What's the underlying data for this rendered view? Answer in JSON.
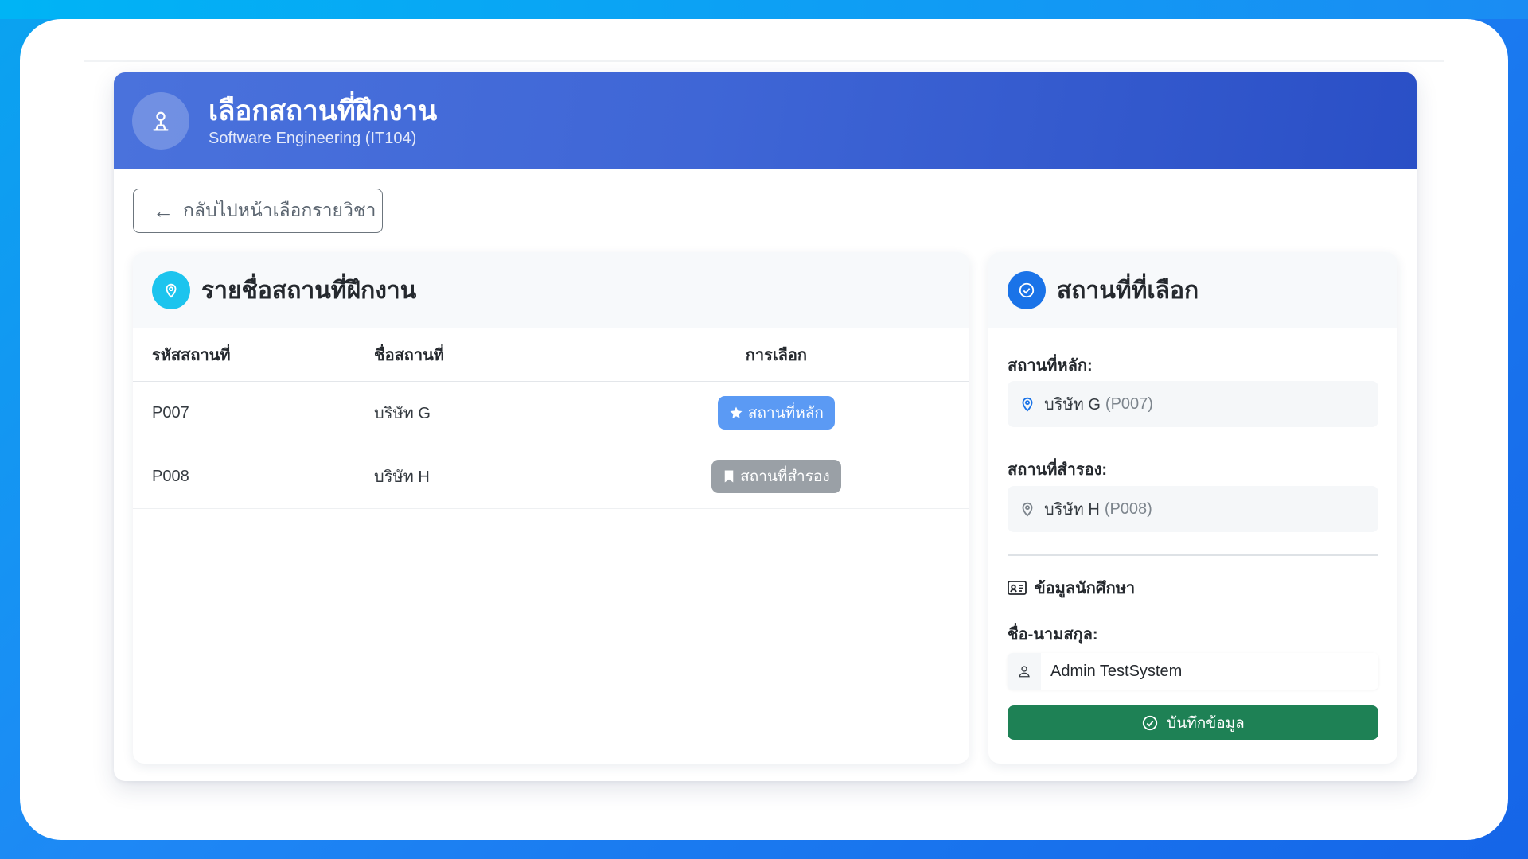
{
  "header": {
    "title": "เลือกสถานที่ฝึกงาน",
    "subtitle": "Software Engineering (IT104)",
    "icon": "user-location-icon"
  },
  "back_button": {
    "label": "กลับไปหน้าเลือกรายวิชา",
    "icon": "arrow-left-icon"
  },
  "places_panel": {
    "title": "รายชื่อสถานที่ฝึกงาน",
    "icon": "map-pin-icon",
    "columns": [
      "รหัสสถานที่",
      "ชื่อสถานที่",
      "การเลือก"
    ],
    "rows": [
      {
        "code": "P007",
        "name": "บริษัท G",
        "choice": "สถานที่หลัก",
        "choice_icon": "star-icon"
      },
      {
        "code": "P008",
        "name": "บริษัท H",
        "choice": "สถานที่สำรอง",
        "choice_icon": "bookmark-icon"
      }
    ]
  },
  "selected_panel": {
    "title": "สถานที่ที่เลือก",
    "icon": "check-circle-icon",
    "primary_label": "สถานที่หลัก:",
    "primary_name": "บริษัท G",
    "primary_code": "(P007)",
    "backup_label": "สถานที่สำรอง:",
    "backup_name": "บริษัท H",
    "backup_code": "(P008)",
    "student_section": "ข้อมูลนักศึกษา",
    "name_label": "ชื่อ-นามสกุล:",
    "name_value": "Admin TestSystem",
    "save_label": "บันทึกข้อมูล"
  },
  "colors": {
    "header_start": "#4a72dc",
    "header_end": "#2a4fc6",
    "primary_badge": "#5b9af4",
    "secondary_badge": "#9aa0a6",
    "save_button": "#1e8155",
    "places_icon_bg": "#1cc4ee",
    "selected_icon_bg": "#1a73e8"
  }
}
